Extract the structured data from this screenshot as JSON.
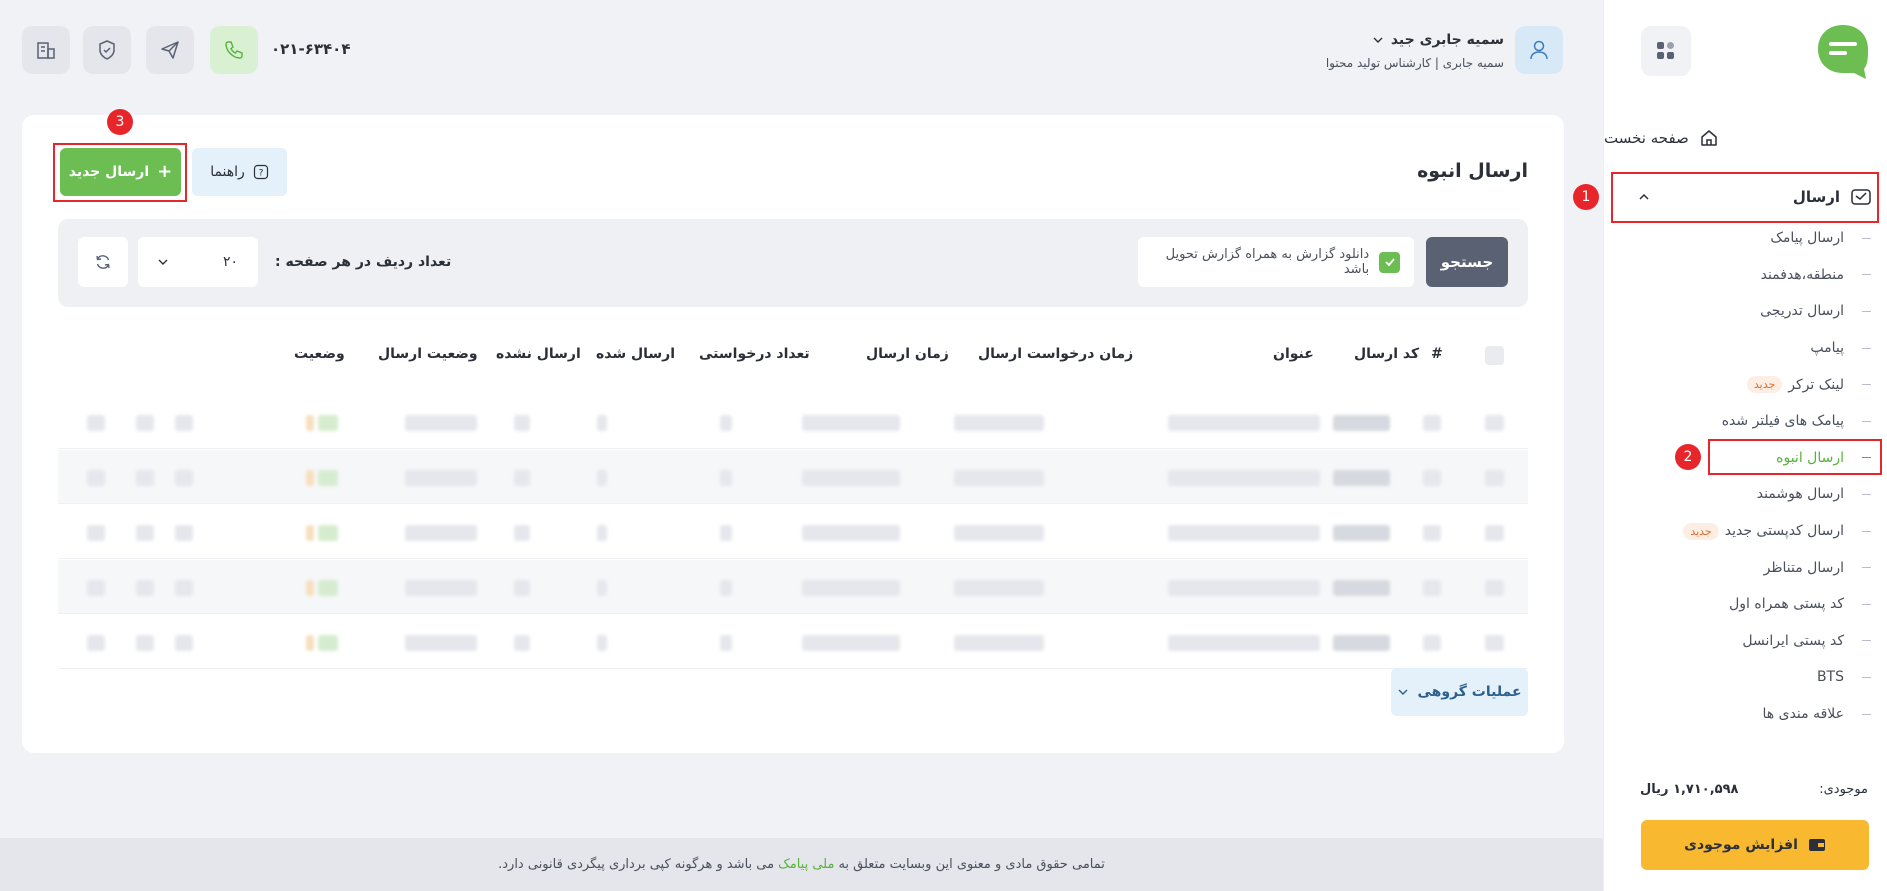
{
  "colors": {
    "accent": "#6cbe52",
    "primary_dark": "#596173",
    "warning": "#f8b931",
    "annotation": "#e6262b"
  },
  "sidebar": {
    "logo_icon": "chat-bubble-logo",
    "home_label": "صفحه نخست",
    "send_label": "ارسال",
    "items": [
      {
        "label": "ارسال پیامک"
      },
      {
        "label": "منطقه،هدفمند"
      },
      {
        "label": "ارسال تدریجی"
      },
      {
        "label": "پیامپ"
      },
      {
        "label": "لینک ترکر",
        "badge": "جدید"
      },
      {
        "label": "پیامک های فیلتر شده"
      },
      {
        "label": "ارسال انبوه",
        "active": true
      },
      {
        "label": "ارسال هوشمند"
      },
      {
        "label": "ارسال کدپستی جدید",
        "badge": "جدید"
      },
      {
        "label": "ارسال متناظر"
      },
      {
        "label": "کد پستی همراه اول"
      },
      {
        "label": "کد پستی ایرانسل"
      },
      {
        "label": "BTS"
      },
      {
        "label": "علاقه مندی ها"
      }
    ],
    "balance_label": "موجودی:",
    "balance_value": "۱,۷۱۰,۵۹۸ ریال",
    "topup_label": "افزایش موجودی"
  },
  "header": {
    "phone": "۰۲۱-۶۳۴۰۴",
    "user_name": "سمیه جابری جید",
    "user_role": "سمیه جابری | کارشناس تولید محتوا"
  },
  "main": {
    "title": "ارسال انبوه",
    "new_button": "ارسال جدید",
    "help_button": "راهنما",
    "search_button": "جستجو",
    "download_report_label": "دانلود گزارش به همراه گزارش تحویل باشد",
    "download_report_checked": true,
    "rows_per_page_label": "تعداد ردیف در هر صفحه :",
    "rows_per_page_value": "۲۰",
    "columns": [
      "#",
      "کد ارسال",
      "عنوان",
      "زمان درخواست ارسال",
      "زمان ارسال",
      "تعداد درخواستی",
      "ارسال شده",
      "ارسال نشده",
      "وضعیت ارسال",
      "وضعیت"
    ],
    "bulk_ops_label": "عملیات گروهی"
  },
  "footer": {
    "text_before": "تمامی حقوق مادی و معنوی این وبسایت متعلق به",
    "link": "ملی پیامک",
    "text_after": "می باشد و هرگونه کپی برداری پیگردی قانونی دارد."
  },
  "annotations": [
    "1",
    "2",
    "3"
  ]
}
